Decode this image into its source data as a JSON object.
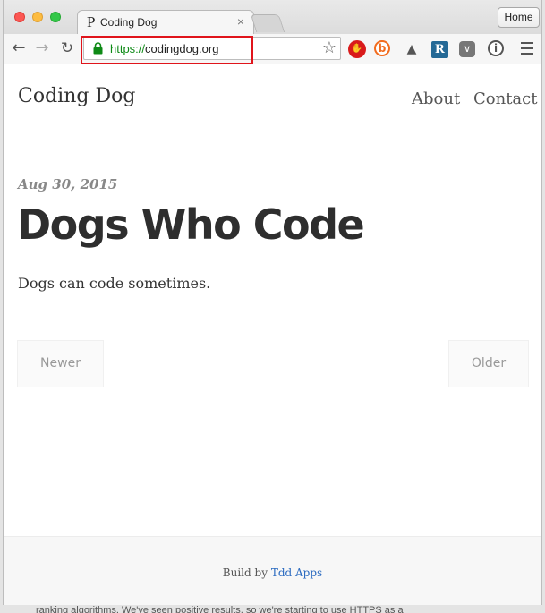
{
  "browser": {
    "tab_title": "Coding Dog",
    "tab_favicon": "P",
    "tab_close": "×",
    "home_button": "Home",
    "url_scheme": "https://",
    "url_host": "codingdog.org"
  },
  "site": {
    "title": "Coding Dog",
    "nav": [
      "About",
      "Contact"
    ]
  },
  "post": {
    "date": "Aug 30, 2015",
    "title": "Dogs Who Code",
    "body": "Dogs can code sometimes."
  },
  "pager": {
    "newer": "Newer",
    "older": "Older"
  },
  "footer": {
    "prefix": "Build by",
    "link": "Tdd Apps"
  },
  "background_text": "ranking algorithms. We've seen positive results, so we're starting to use HTTPS as a",
  "colors": {
    "url_scheme": "#0e8a16",
    "highlight_box": "#e0141b",
    "footer_link": "#2a6ac0"
  }
}
